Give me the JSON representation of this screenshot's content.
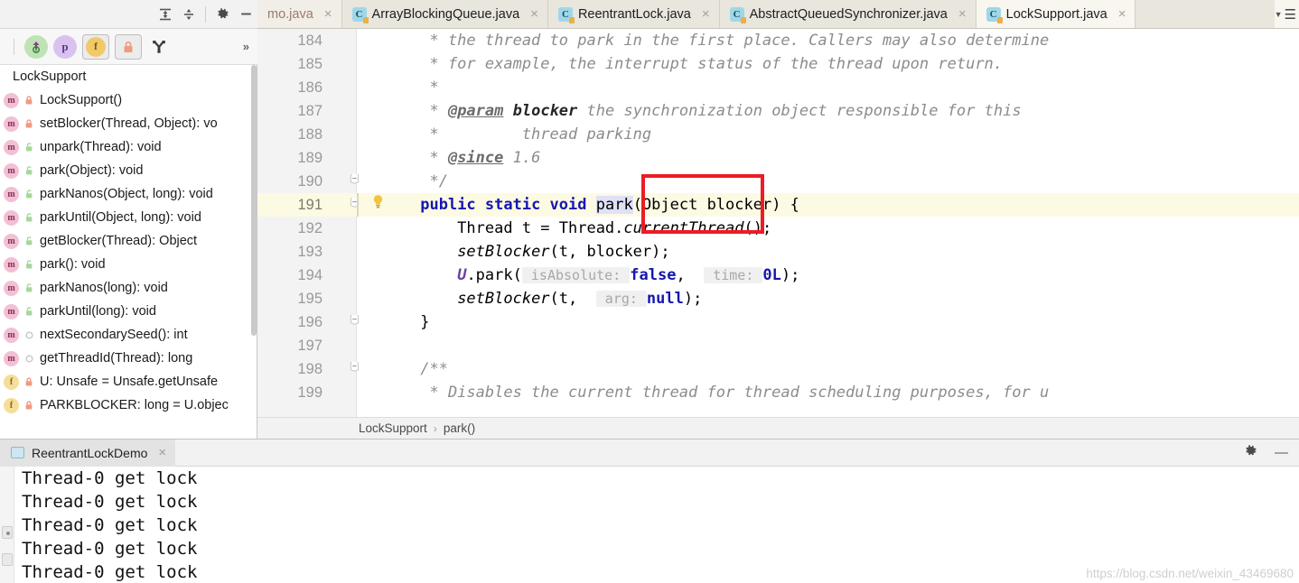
{
  "window": {
    "top_toolbar": {
      "icons": [
        {
          "name": "expand-all-icon",
          "glyph": "⩯"
        },
        {
          "name": "collapse-all-icon",
          "glyph": "⩰"
        },
        {
          "name": "settings-gear-icon",
          "glyph": "⚙"
        },
        {
          "name": "hide-panel-icon",
          "glyph": "—"
        }
      ]
    },
    "structure_toolbar": {
      "icons": [
        {
          "name": "sort-alphabetically-icon",
          "label": "↑",
          "color": "#b8e0b0",
          "text": "i"
        },
        {
          "name": "show-properties-icon",
          "label": "p",
          "color": "#d9c2f0"
        },
        {
          "name": "show-fields-icon",
          "label": "f",
          "color": "#f2c969"
        },
        {
          "name": "show-non-public-icon",
          "label": "🔒",
          "color": "#f0a58e"
        },
        {
          "name": "show-inherited-icon",
          "label": "Y",
          "color": "#444444"
        }
      ],
      "overflow_label": "»"
    }
  },
  "editor_tabs": [
    {
      "label": "mo.java",
      "active": false,
      "truncated": true,
      "icon": null
    },
    {
      "label": "ArrayBlockingQueue.java",
      "active": false,
      "icon": "java-class-icon"
    },
    {
      "label": "ReentrantLock.java",
      "active": false,
      "icon": "java-class-icon"
    },
    {
      "label": "AbstractQueuedSynchronizer.java",
      "active": false,
      "icon": "java-class-icon"
    },
    {
      "label": "LockSupport.java",
      "active": true,
      "icon": "java-class-icon"
    }
  ],
  "structure_panel": {
    "root": "LockSupport",
    "items": [
      {
        "label": "LockSupport()",
        "kind": "method",
        "visibility": "private"
      },
      {
        "label": "setBlocker(Thread, Object): vo",
        "kind": "method",
        "visibility": "private"
      },
      {
        "label": "unpark(Thread): void",
        "kind": "method",
        "visibility": "public"
      },
      {
        "label": "park(Object): void",
        "kind": "method",
        "visibility": "public"
      },
      {
        "label": "parkNanos(Object, long): void",
        "kind": "method",
        "visibility": "public"
      },
      {
        "label": "parkUntil(Object, long): void",
        "kind": "method",
        "visibility": "public"
      },
      {
        "label": "getBlocker(Thread): Object",
        "kind": "method",
        "visibility": "public"
      },
      {
        "label": "park(): void",
        "kind": "method",
        "visibility": "public"
      },
      {
        "label": "parkNanos(long): void",
        "kind": "method",
        "visibility": "public"
      },
      {
        "label": "parkUntil(long): void",
        "kind": "method",
        "visibility": "public"
      },
      {
        "label": "nextSecondarySeed(): int",
        "kind": "method",
        "visibility": "package"
      },
      {
        "label": "getThreadId(Thread): long",
        "kind": "method",
        "visibility": "package"
      },
      {
        "label": "U: Unsafe = Unsafe.getUnsafe",
        "kind": "field",
        "visibility": "private"
      },
      {
        "label": "PARKBLOCKER: long = U.objec",
        "kind": "field",
        "visibility": "private"
      }
    ]
  },
  "code": {
    "lines": [
      {
        "num": "184",
        "indent": 0,
        "segments": [
          {
            "t": "  * the thread to park in the first place. Callers may also determine",
            "c": "cmt"
          }
        ]
      },
      {
        "num": "185",
        "segments": [
          {
            "t": "  * for example, the interrupt status of the thread upon return.",
            "c": "cmt"
          }
        ]
      },
      {
        "num": "186",
        "segments": [
          {
            "t": "  *",
            "c": "cmt"
          }
        ]
      },
      {
        "num": "187",
        "segments": [
          {
            "t": "  * ",
            "c": "cmt"
          },
          {
            "t": "@param",
            "c": "cmtT"
          },
          {
            "t": " ",
            "c": "cmt"
          },
          {
            "t": "blocker",
            "c": "cmtB"
          },
          {
            "t": " the synchronization object responsible for this",
            "c": "cmt"
          }
        ]
      },
      {
        "num": "188",
        "segments": [
          {
            "t": "  *         thread parking",
            "c": "cmt"
          }
        ]
      },
      {
        "num": "189",
        "segments": [
          {
            "t": "  * ",
            "c": "cmt"
          },
          {
            "t": "@since",
            "c": "cmtT"
          },
          {
            "t": " 1.6",
            "c": "cmt"
          }
        ]
      },
      {
        "num": "190",
        "fold": "⊖",
        "segments": [
          {
            "t": "  */",
            "c": "cmt"
          }
        ]
      },
      {
        "num": "191",
        "fold": "⊖",
        "bulb": true,
        "highlight": true,
        "segments": [
          {
            "t": " ",
            "c": "plain"
          },
          {
            "t": "public static void",
            "c": "kw"
          },
          {
            "t": " ",
            "c": "plain"
          },
          {
            "t": "park",
            "c": "sel"
          },
          {
            "t": "(Object blocker) {",
            "c": "plain"
          }
        ]
      },
      {
        "num": "192",
        "segments": [
          {
            "t": "     Thread t = Thread.",
            "c": "plain"
          },
          {
            "t": "currentThread",
            "c": "ital"
          },
          {
            "t": "();",
            "c": "plain"
          }
        ]
      },
      {
        "num": "193",
        "segments": [
          {
            "t": "     ",
            "c": "plain"
          },
          {
            "t": "setBlocker",
            "c": "ital"
          },
          {
            "t": "(t, blocker);",
            "c": "plain"
          }
        ]
      },
      {
        "num": "194",
        "segments": [
          {
            "t": "     ",
            "c": "plain"
          },
          {
            "t": "U",
            "c": "fieldU"
          },
          {
            "t": ".park(",
            "c": "plain"
          },
          {
            "t": " isAbsolute: ",
            "c": "hint"
          },
          {
            "t": "false",
            "c": "kw"
          },
          {
            "t": ",  ",
            "c": "plain"
          },
          {
            "t": " time: ",
            "c": "hint"
          },
          {
            "t": "0L",
            "c": "kw"
          },
          {
            "t": ");",
            "c": "plain"
          }
        ]
      },
      {
        "num": "195",
        "segments": [
          {
            "t": "     ",
            "c": "plain"
          },
          {
            "t": "setBlocker",
            "c": "ital"
          },
          {
            "t": "(t,  ",
            "c": "plain"
          },
          {
            "t": " arg: ",
            "c": "hint"
          },
          {
            "t": "null",
            "c": "kw"
          },
          {
            "t": ");",
            "c": "plain"
          }
        ]
      },
      {
        "num": "196",
        "fold": "⊖",
        "segments": [
          {
            "t": " }",
            "c": "plain"
          }
        ]
      },
      {
        "num": "197",
        "segments": [
          {
            "t": "",
            "c": "plain"
          }
        ]
      },
      {
        "num": "198",
        "fold": "⊖",
        "segments": [
          {
            "t": " /**",
            "c": "cmt"
          }
        ]
      },
      {
        "num": "199",
        "segments": [
          {
            "t": "  * Disables the current thread for thread scheduling purposes, for u",
            "c": "cmt"
          }
        ]
      }
    ]
  },
  "breadcrumb": {
    "class": "LockSupport",
    "separator": "›",
    "method": "park()"
  },
  "run_panel": {
    "tab_label": "ReentrantLockDemo",
    "tab_close": "×",
    "settings_icon": "gear-icon",
    "minimize_icon": "—",
    "console_lines": [
      "Thread-0 get lock",
      "Thread-0 get lock",
      "Thread-0 get lock",
      "Thread-0 get lock",
      "Thread-0 get lock"
    ]
  },
  "watermark": "https://blog.csdn.net/weixin_43469680",
  "annotation": {
    "type": "red-rectangle",
    "target_text": "park(Obj"
  },
  "colors": {
    "accent_red": "#ec1c24",
    "highlight_line": "#fcfae3",
    "tab_active": "#f8f6ef",
    "tab_bar": "#e8e6dd",
    "keyword_blue": "#1616b0",
    "comment_gray": "#8c8c8c"
  }
}
